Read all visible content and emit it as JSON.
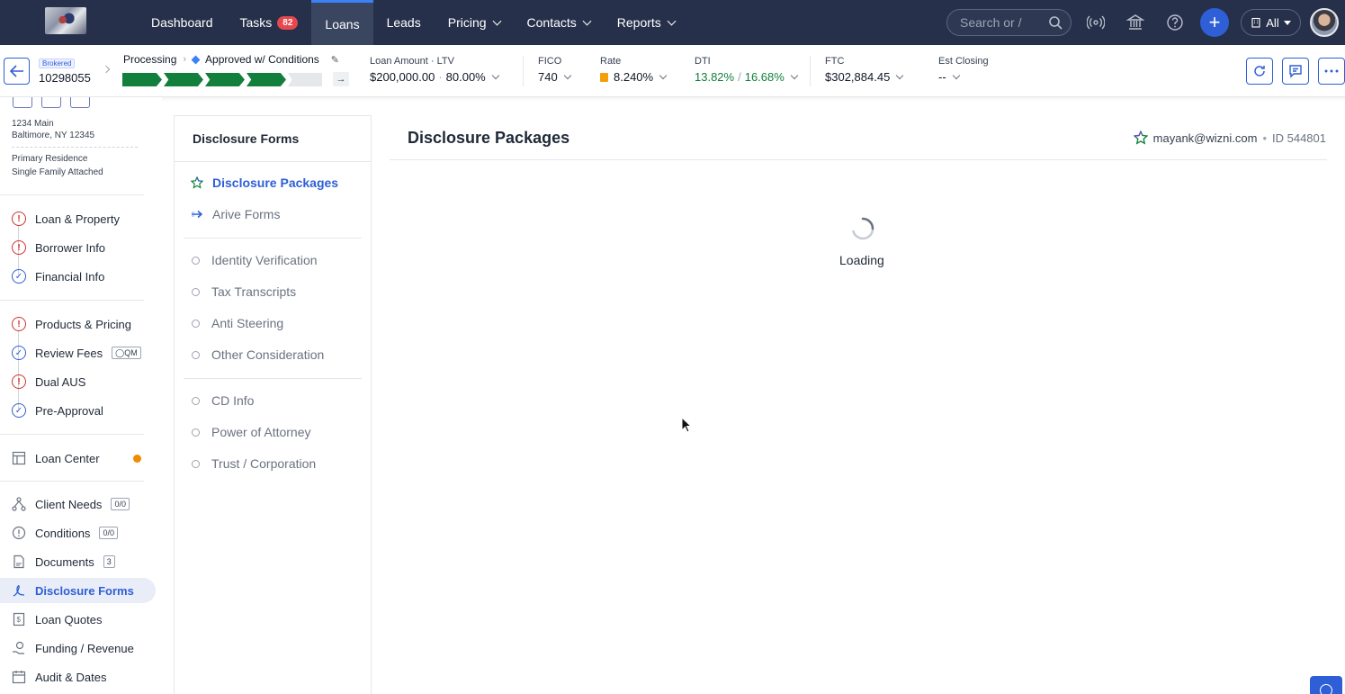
{
  "nav": {
    "tabs": [
      {
        "label": "Dashboard"
      },
      {
        "label": "Tasks",
        "badge": "82"
      },
      {
        "label": "Loans",
        "active": true
      },
      {
        "label": "Leads"
      },
      {
        "label": "Pricing"
      },
      {
        "label": "Contacts"
      },
      {
        "label": "Reports"
      }
    ],
    "search_placeholder": "Search or /",
    "all_label": "All",
    "icons": [
      "broadcast-icon",
      "bank-icon",
      "help-icon",
      "plus-icon"
    ]
  },
  "loan": {
    "type_badge": "Brokered",
    "number": "10298055",
    "stage": "Processing",
    "status": "Approved w/ Conditions",
    "progress": {
      "completed_segments": 4,
      "total_segments": 5
    },
    "metrics": {
      "loan_amount_label": "Loan Amount",
      "ltv_label": "LTV",
      "loan_amount": "$200,000.00",
      "ltv": "80.00%",
      "fico_label": "FICO",
      "fico": "740",
      "rate_label": "Rate",
      "rate": "8.240%",
      "dti_label": "DTI",
      "dti_front": "13.82%",
      "dti_sep": "/",
      "dti_back": "16.68%",
      "ftc_label": "FTC",
      "ftc": "$302,884.45",
      "closing_label": "Est Closing",
      "closing": "--"
    }
  },
  "sidebar": {
    "address_line1": "1234 Main",
    "address_line2": "Baltimore, NY 12345",
    "occupancy": "Primary Residence",
    "property_type": "Single Family Attached",
    "group1": [
      {
        "label": "Loan & Property",
        "status": "error"
      },
      {
        "label": "Borrower Info",
        "status": "error"
      },
      {
        "label": "Financial Info",
        "status": "ok"
      }
    ],
    "group2": [
      {
        "label": "Products & Pricing",
        "status": "error"
      },
      {
        "label": "Review Fees",
        "status": "ok",
        "tag": "QM"
      },
      {
        "label": "Dual AUS",
        "status": "error"
      },
      {
        "label": "Pre-Approval",
        "status": "ok"
      }
    ],
    "loan_center": "Loan Center",
    "group3": [
      {
        "label": "Client Needs",
        "tag": "0/0"
      },
      {
        "label": "Conditions",
        "tag": "0/0"
      },
      {
        "label": "Documents",
        "tag": "3"
      },
      {
        "label": "Disclosure Forms",
        "active": true
      },
      {
        "label": "Loan Quotes"
      },
      {
        "label": "Funding / Revenue"
      },
      {
        "label": "Audit & Dates"
      }
    ]
  },
  "forms_panel": {
    "title": "Disclosure Forms",
    "primary": [
      {
        "label": "Disclosure Packages",
        "selected": true
      },
      {
        "label": "Arive Forms"
      }
    ],
    "section1": [
      "Identity Verification",
      "Tax Transcripts",
      "Anti Steering",
      "Other Consideration"
    ],
    "section2": [
      "CD Info",
      "Power of Attorney",
      "Trust / Corporation"
    ]
  },
  "main": {
    "title": "Disclosure Packages",
    "user_email": "mayank@wizni.com",
    "id_label": "ID 544801",
    "loading_text": "Loading"
  },
  "colors": {
    "nav_bg": "#27304a",
    "accent": "#2e5fd6",
    "progress_green": "#12803c",
    "error_red": "#d0312d"
  }
}
